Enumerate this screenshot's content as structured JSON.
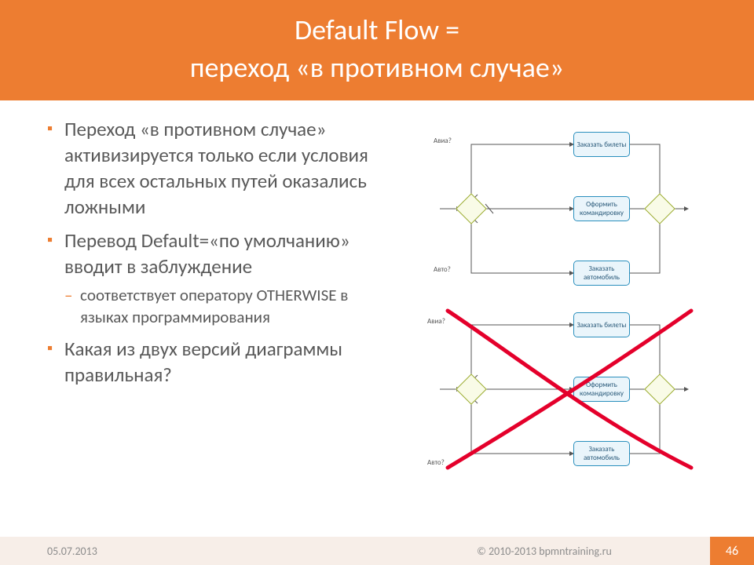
{
  "title_line1": "Default Flow =",
  "title_line2": "переход «в противном случае»",
  "bullets": {
    "b1": "Переход «в противном случае» активизируется только если условия для всех остальных путей оказались ложными",
    "b2": "Перевод Default=«по умолчанию» вводит в заблуждение",
    "b2s1": "соответствует оператору OTHERWISE в языках программирования",
    "b3": "Какая из двух версий диаграммы правильная?"
  },
  "diagram": {
    "labels": {
      "avia": "Авиа?",
      "avto": "Авто?"
    },
    "tasks": {
      "t1": "Заказать билеты",
      "t2": "Оформить командировку",
      "t3": "Заказать автомобиль",
      "t4": "Заказать билеты",
      "t5": "Оформить командировку",
      "t6": "Заказать автомобиль"
    }
  },
  "footer": {
    "date": "05.07.2013",
    "copy": "© 2010-2013 bpmntraining.ru",
    "page": "46"
  }
}
